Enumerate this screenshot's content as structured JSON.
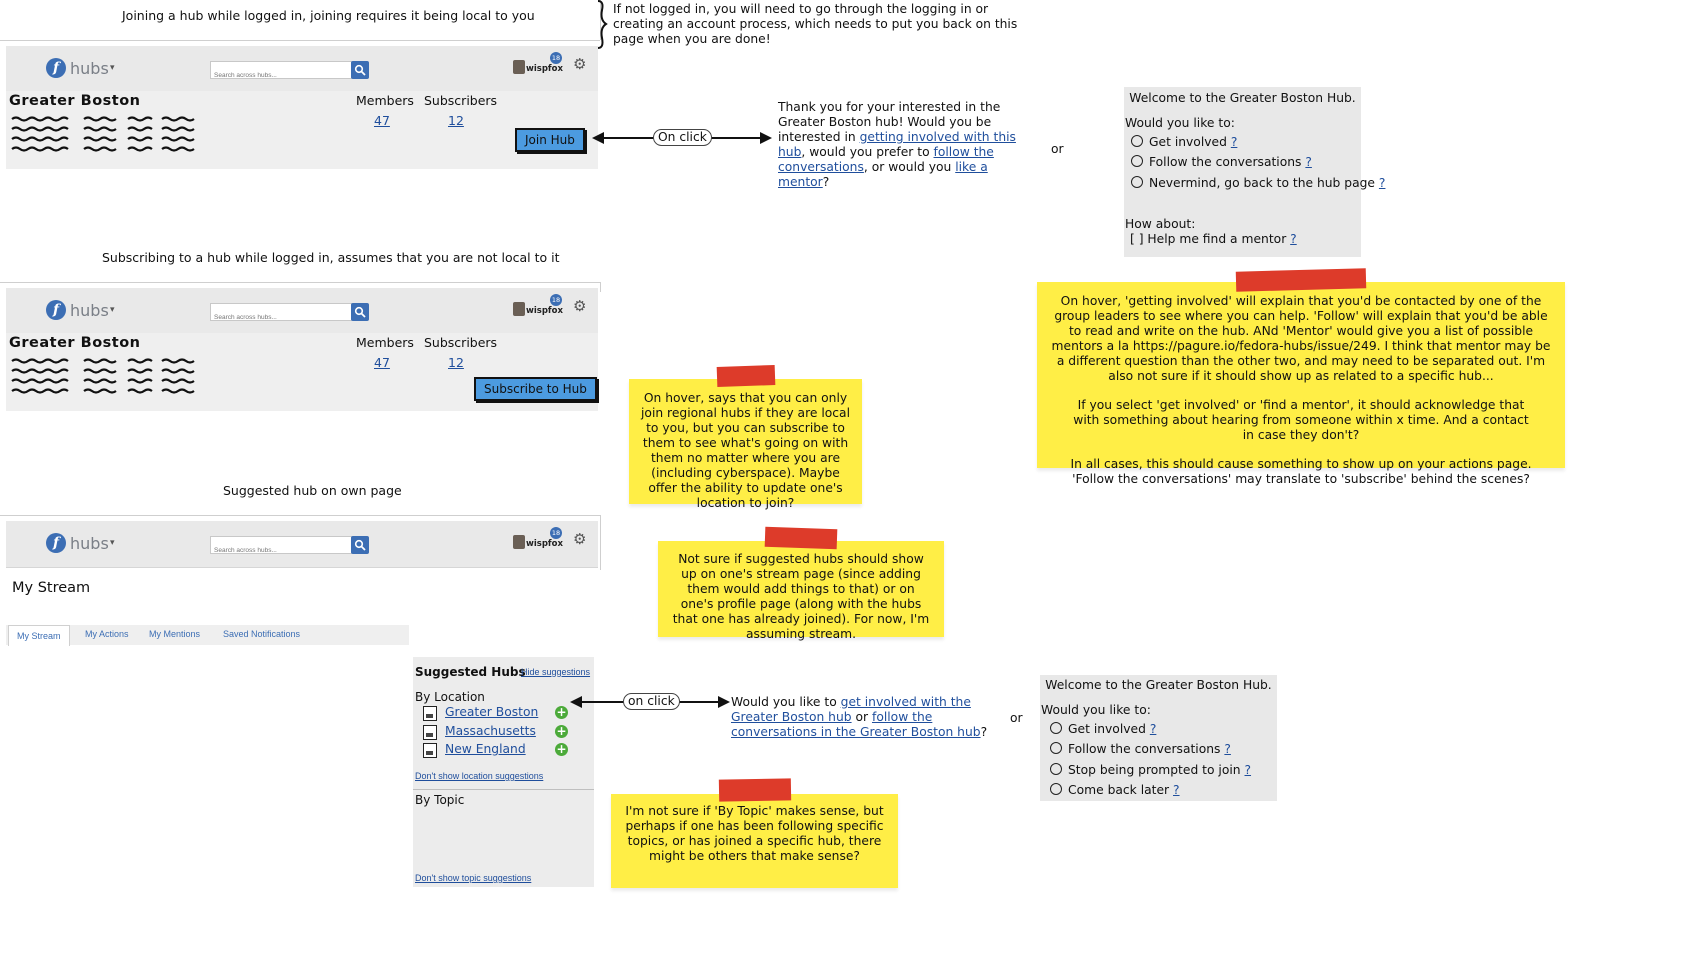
{
  "captions": {
    "joining": "Joining a hub while logged in, joining requires it being local to you",
    "subscribing": "Subscribing to a hub while logged in, assumes that you are not local to it",
    "suggested": "Suggested hub on own page",
    "not_logged_in": "If not logged in, you will need to go through the logging in or creating an account process, which needs to put you back on this page when you are done!"
  },
  "navbar": {
    "logo_glyph": "f",
    "brand": "hubs",
    "search_placeholder": "Search across hubs...",
    "username": "wispfox",
    "notification_count": "18",
    "icons": [
      "fedora-logo-icon",
      "chevron-down-icon",
      "search-icon",
      "avatar",
      "gear-icon"
    ]
  },
  "hub": {
    "title": "Greater Boston",
    "members_label": "Members",
    "members_count": "47",
    "subscribers_label": "Subscribers",
    "subscribers_count": "12",
    "join_button": "Join Hub",
    "subscribe_button": "Subscribe to Hub"
  },
  "arrows": {
    "on_click": "On click",
    "on_click_lower": "on click",
    "or": "or"
  },
  "join_response": {
    "p1": "Thank you for your interested in the Greater Boston hub! Would you be interested in ",
    "link1": "getting involved with this hub",
    "p2": ", would you prefer to ",
    "link2": "follow the conversations",
    "p3": ", or would you ",
    "link3": "like a mentor",
    "p4": "?"
  },
  "dialog1": {
    "title": "Welcome to the Greater Boston Hub.",
    "prompt": "Would you like to:",
    "options": [
      "Get involved",
      "Follow the conversations",
      "Nevermind, go back to the hub page"
    ],
    "help": "?",
    "how_about": "How about:",
    "checkbox": "[ ] Help me find a mentor"
  },
  "dialog2": {
    "title": "Welcome to the Greater Boston Hub.",
    "prompt": "Would you like to:",
    "options": [
      "Get involved",
      "Follow the conversations",
      "Stop being prompted to join",
      "Come back later"
    ],
    "help": "?"
  },
  "notes": {
    "hover_join": "On hover, says that you can only join regional hubs if they are local to you, but you can subscribe to them to see what's going on with them no matter where you are (including cyberspace). Maybe offer the ability to update one's location to join?",
    "stream": "Not sure if suggested hubs should show up on one's stream page (since adding them would add things to that) or on one's profile page (along with the hubs that one has already joined). For now, I'm assuming stream.",
    "by_topic": "I'm not sure if 'By Topic' makes sense, but perhaps if one has been following specific topics, or has joined a specific hub, there might be others that make sense?",
    "big_p1": "On hover, 'getting involved' will explain that you'd be contacted by one of the group leaders to see where you can help. 'Follow' will explain that you'd be able to read and write on the hub. ANd 'Mentor' would give you a list of possible mentors a la https://pagure.io/fedora-hubs/issue/249. I think that mentor may be a different question than the other two, and may need to be separated out. I'm also not sure if it should show up as related to a specific hub...",
    "big_p2": "If you select 'get involved' or 'find a mentor', it should acknowledge that with something about hearing from someone within x time. And a contact in case they don't?",
    "big_p3": "In all cases, this should cause something to show up on your actions page. 'Follow the conversations' may translate to 'subscribe' behind the scenes?"
  },
  "stream": {
    "title": "My Stream",
    "tabs": [
      "My Stream",
      "My Actions",
      "My Mentions",
      "Saved Notifications"
    ]
  },
  "suggested": {
    "heading": "Suggested Hubs",
    "hide": "Hide suggestions",
    "by_location": "By Location",
    "location_hubs": [
      "Greater Boston",
      "Massachusetts",
      "New England"
    ],
    "dont_show_location": "Don't show location suggestions",
    "by_topic": "By Topic",
    "dont_show_topic": "Don't show topic suggestions"
  },
  "suggest_response": {
    "p1": "Would you like to ",
    "link1": "get involved with the Greater Boston hub",
    "p2": " or ",
    "link2": "follow the conversations in the Greater Boston hub",
    "p3": "?"
  }
}
